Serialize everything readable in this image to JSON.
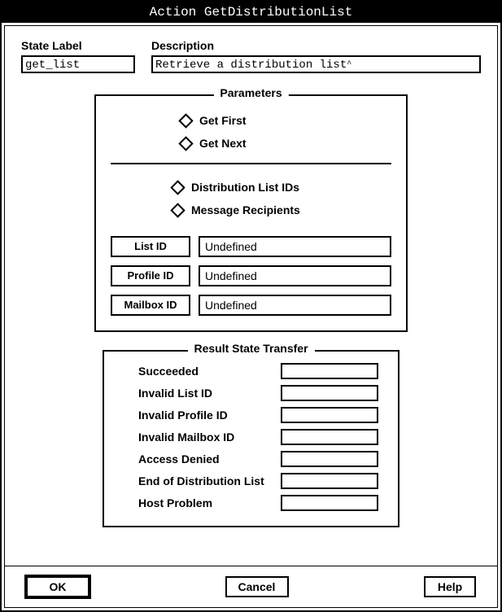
{
  "title": "Action GetDistributionList",
  "stateLabel": {
    "label": "State Label",
    "value": "get_list"
  },
  "description": {
    "label": "Description",
    "value": "Retrieve a distribution list"
  },
  "parameters": {
    "legend": "Parameters",
    "group1": [
      {
        "label": "Get First"
      },
      {
        "label": "Get Next"
      }
    ],
    "group2": [
      {
        "label": "Distribution List IDs"
      },
      {
        "label": "Message Recipients"
      }
    ],
    "ids": [
      {
        "label": "List ID",
        "value": "Undefined"
      },
      {
        "label": "Profile ID",
        "value": "Undefined"
      },
      {
        "label": "Mailbox ID",
        "value": "Undefined"
      }
    ]
  },
  "resultTransfer": {
    "legend": "Result State Transfer",
    "rows": [
      {
        "label": "Succeeded",
        "value": ""
      },
      {
        "label": "Invalid List ID",
        "value": ""
      },
      {
        "label": "Invalid Profile ID",
        "value": ""
      },
      {
        "label": "Invalid Mailbox ID",
        "value": ""
      },
      {
        "label": "Access Denied",
        "value": ""
      },
      {
        "label": "End of Distribution List",
        "value": ""
      },
      {
        "label": "Host Problem",
        "value": ""
      }
    ]
  },
  "buttons": {
    "ok": "OK",
    "cancel": "Cancel",
    "help": "Help"
  }
}
